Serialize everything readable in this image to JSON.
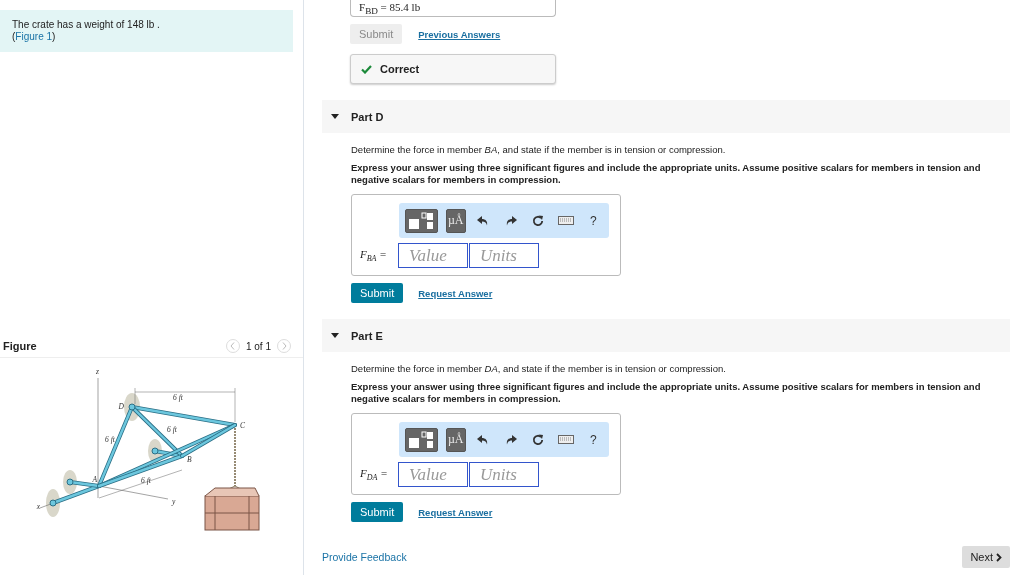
{
  "problem": {
    "text": "The crate has a weight of 148 lb .",
    "figure_ref": {
      "before": "(",
      "link": "Figure 1",
      "after": ")"
    }
  },
  "figure": {
    "title": "Figure",
    "pager": "1 of 1",
    "labels": [
      "z",
      "D",
      "6 ft",
      "C",
      "6 ft",
      "6 ft",
      "B",
      "A",
      "6 ft",
      "y",
      "x"
    ]
  },
  "prior_answer": {
    "label": "F$_{BD}$ =",
    "value": "85.4 lb"
  },
  "prior_actions": {
    "submit": "Submit",
    "submit_disabled": true,
    "previous": "Previous Answers"
  },
  "feedback": {
    "text": "Correct"
  },
  "parts": [
    {
      "title": "Part D",
      "expanded": true,
      "question": "Determine the force in member *BA*, and state if the member is in tension or compression.",
      "instructions": "Express your answer using three significant figures and include the appropriate units. Assume positive scalars for members in tension and negative scalars for members in compression.",
      "toolbar": [
        {
          "kind": "templates"
        },
        {
          "kind": "units",
          "label": "µÅ"
        },
        {
          "kind": "undo"
        },
        {
          "kind": "redo"
        },
        {
          "kind": "reset"
        },
        {
          "kind": "keyboard"
        },
        {
          "kind": "help",
          "label": "?"
        }
      ],
      "answer_label": "F$_{BA}$ =",
      "value_placeholder": "Value",
      "units_placeholder": "Units",
      "submit": "Submit",
      "request": "Request Answer"
    },
    {
      "title": "Part E",
      "expanded": true,
      "question": "Determine the force in member *DA*, and state if the member is in tension or compression.",
      "instructions": "Express your answer using three significant figures and include the appropriate units. Assume positive scalars for members in tension and negative scalars for members in compression.",
      "toolbar": [
        {
          "kind": "templates"
        },
        {
          "kind": "units",
          "label": "µÅ"
        },
        {
          "kind": "undo"
        },
        {
          "kind": "redo"
        },
        {
          "kind": "reset"
        },
        {
          "kind": "keyboard"
        },
        {
          "kind": "help",
          "label": "?"
        }
      ],
      "answer_label": "F$_{DA}$ =",
      "value_placeholder": "Value",
      "units_placeholder": "Units",
      "submit": "Submit",
      "request": "Request Answer"
    }
  ],
  "footer": {
    "feedback": "Provide Feedback",
    "next": "Next"
  }
}
